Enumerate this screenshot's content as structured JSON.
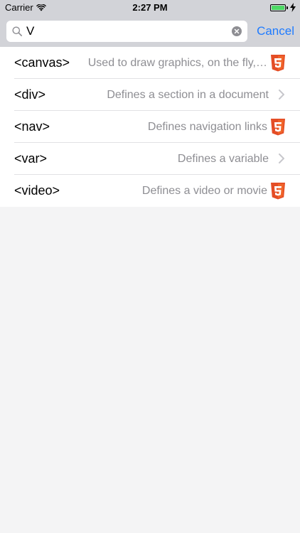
{
  "status_bar": {
    "carrier": "Carrier",
    "time": "2:27 PM",
    "battery_level": 1.0,
    "battery_color": "#4cd964"
  },
  "search": {
    "value": "V",
    "cancel_label": "Cancel"
  },
  "results": [
    {
      "tag": "<canvas>",
      "description": "Used to draw graphics, on the fly,…",
      "accessory": "html5-icon"
    },
    {
      "tag": "<div>",
      "description": "Defines a section in a document",
      "accessory": "chevron-right-icon"
    },
    {
      "tag": "<nav>",
      "description": "Defines navigation links",
      "accessory": "html5-icon"
    },
    {
      "tag": "<var>",
      "description": "Defines a variable",
      "accessory": "chevron-right-icon"
    },
    {
      "tag": "<video>",
      "description": "Defines a video or movie",
      "accessory": "html5-icon"
    }
  ],
  "colors": {
    "accent": "#1f7bff",
    "html5_badge": "#e44d26",
    "bar_background": "#d2d3d8",
    "page_background": "#f4f4f5"
  }
}
